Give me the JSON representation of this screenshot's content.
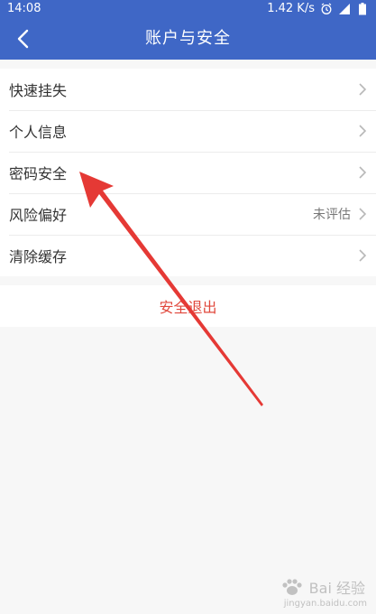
{
  "status_bar": {
    "time": "14:08",
    "network_speed": "1.42 K/s",
    "icons": [
      "alarm-icon",
      "signal-icon",
      "battery-icon"
    ]
  },
  "nav": {
    "title": "账户与安全",
    "back_icon": "back-arrow-icon"
  },
  "menu": {
    "items": [
      {
        "label": "快速挂失",
        "value": ""
      },
      {
        "label": "个人信息",
        "value": ""
      },
      {
        "label": "密码安全",
        "value": ""
      },
      {
        "label": "风险偏好",
        "value": "未评估"
      },
      {
        "label": "清除缓存",
        "value": ""
      }
    ]
  },
  "logout": {
    "label": "安全退出"
  },
  "colors": {
    "brand_blue": "#3f67c6",
    "logout_red": "#e0483c",
    "annotation_red": "#e53935"
  },
  "watermark": {
    "text": "Bai 经验",
    "sub": "jingyan.baidu.com"
  }
}
